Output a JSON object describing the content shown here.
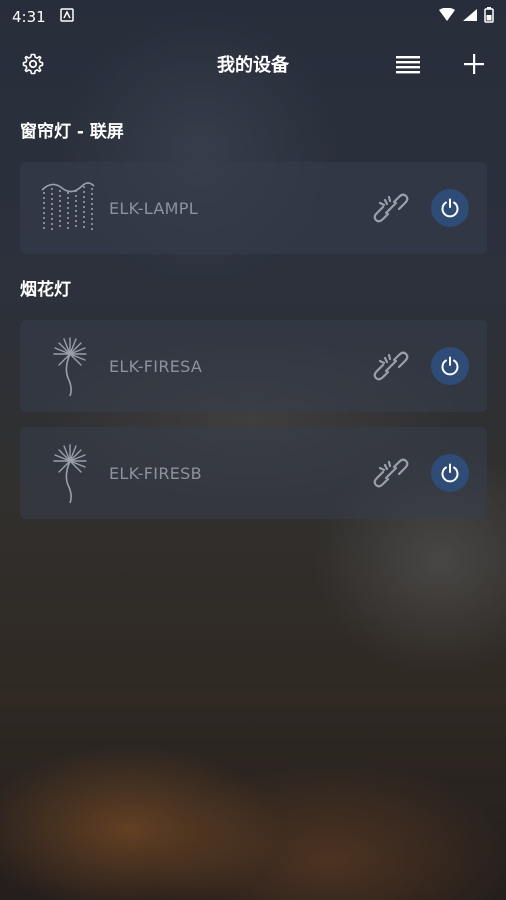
{
  "status_bar": {
    "time": "4:31"
  },
  "app_bar": {
    "title": "我的设备"
  },
  "groups": [
    {
      "title": "窗帘灯 - 联屏",
      "devices": [
        {
          "name": "ELK-LAMPL",
          "icon": "curtain-light-icon"
        }
      ]
    },
    {
      "title": "烟花灯",
      "devices": [
        {
          "name": "ELK-FIRESA",
          "icon": "firework-light-icon"
        },
        {
          "name": "ELK-FIRESB",
          "icon": "firework-light-icon"
        }
      ]
    }
  ],
  "colors": {
    "power_button": "#2f4c76",
    "device_name": "#8d939e",
    "card_bg": "#373e4c"
  }
}
